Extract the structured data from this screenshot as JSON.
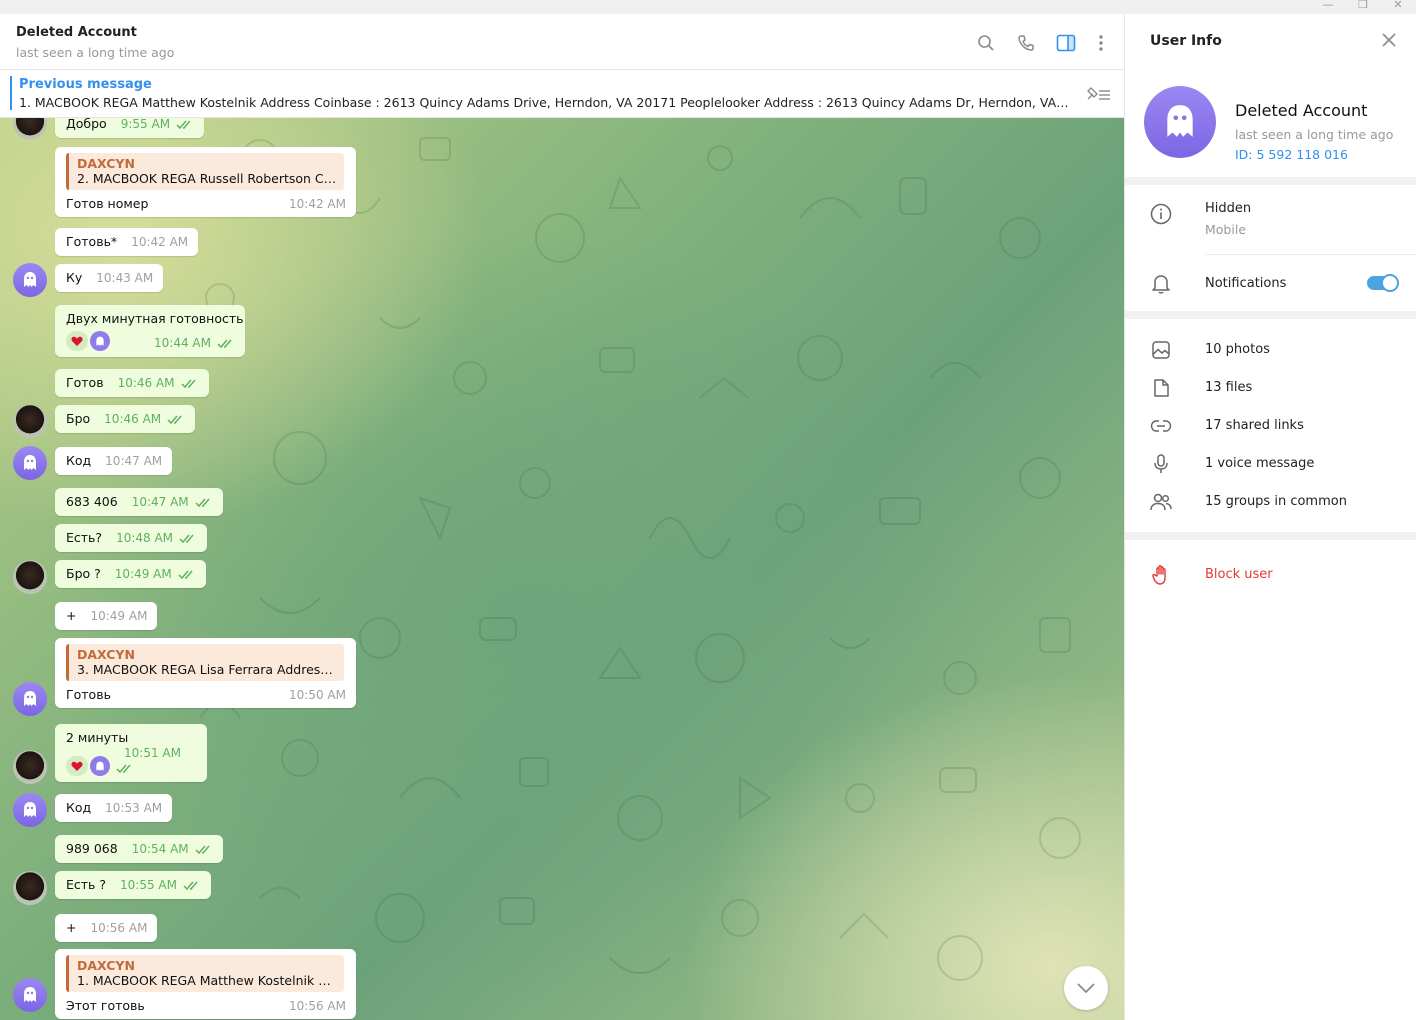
{
  "window": {
    "minimize": "—",
    "restore": "❐",
    "close": "✕"
  },
  "header": {
    "title": "Deleted Account",
    "status": "last seen a long time ago"
  },
  "pinned": {
    "title": "Previous message",
    "text": "1. MACBOOK REGA  Matthew Kostelnik  Address Coinbase : 2613 Quincy Adams Drive, Herndon, VA 20171   Peoplelooker Address : 2613 Quincy Adams Dr, Herndon, VA 20171 S..."
  },
  "messages": [
    {
      "text": "Добро",
      "time": "9:55 AM"
    },
    {
      "reply_name": "DAXCYN",
      "reply_text": "2.  MACBOOK REGA  Russell Robertson Coi...",
      "text": "Готов номер",
      "time": "10:42 AM"
    },
    {
      "text": "Готовь*",
      "time": "10:42 AM"
    },
    {
      "text": "Ку",
      "time": "10:43 AM"
    },
    {
      "text": "Двух минутная готовность",
      "time": "10:44 AM"
    },
    {
      "text": "Готов",
      "time": "10:46 AM"
    },
    {
      "text": "Бро",
      "time": "10:46 AM"
    },
    {
      "text": "Код",
      "time": "10:47 AM"
    },
    {
      "text": "683 406",
      "time": "10:47 AM"
    },
    {
      "text": "Есть?",
      "time": "10:48 AM"
    },
    {
      "text": "Бро ?",
      "time": "10:49 AM"
    },
    {
      "text": "+",
      "time": "10:49 AM"
    },
    {
      "reply_name": "DAXCYN",
      "reply_text": "3.   MACBOOK REGA   Lisa Ferrara  Address ...",
      "text": "Готовь",
      "time": "10:50 AM"
    },
    {
      "text": "2 минуты",
      "time": "10:51 AM"
    },
    {
      "text": "Код",
      "time": "10:53 AM"
    },
    {
      "text": "989 068",
      "time": "10:54 AM"
    },
    {
      "text": "Есть ?",
      "time": "10:55 AM"
    },
    {
      "text": "+",
      "time": "10:56 AM"
    },
    {
      "reply_name": "DAXCYN",
      "reply_text": "1. MACBOOK REGA  Matthew Kostelnik  Ad...",
      "text": "Этот готовь",
      "time": "10:56 AM"
    }
  ],
  "user_info": {
    "title": "User Info",
    "name": "Deleted Account",
    "status": "last seen a long time ago",
    "id": "ID: 5 592 118 016",
    "phone_value": "Hidden",
    "phone_label": "Mobile",
    "notifications_label": "Notifications",
    "notifications_on": true,
    "media": [
      {
        "icon": "photo-icon",
        "label": "10 photos"
      },
      {
        "icon": "file-icon",
        "label": "13 files"
      },
      {
        "icon": "link-icon",
        "label": "17 shared links"
      },
      {
        "icon": "microphone-icon",
        "label": "1 voice message"
      },
      {
        "icon": "groups-icon",
        "label": "15 groups in common"
      }
    ],
    "block_label": "Block user"
  },
  "colors": {
    "accent": "#3390ec",
    "outgoing_bubble": "#effdde",
    "incoming_bubble": "#ffffff",
    "reply_accent": "#c26b3a",
    "danger": "#e53935"
  }
}
